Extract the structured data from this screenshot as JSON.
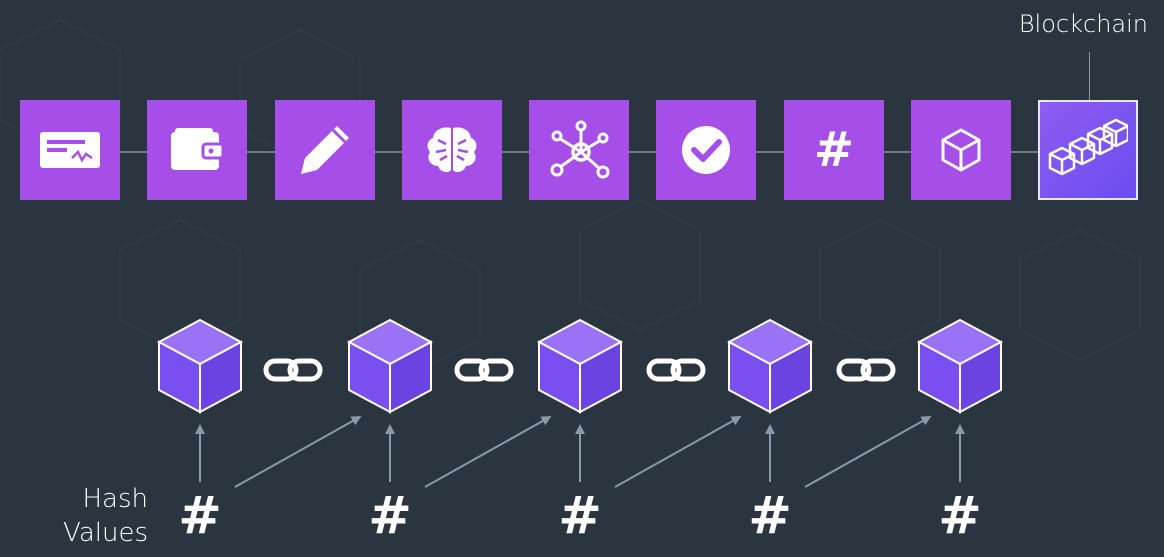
{
  "header": {
    "label": "Blockchain"
  },
  "pipeline": {
    "steps": [
      {
        "icon": "check-document-icon"
      },
      {
        "icon": "wallet-icon"
      },
      {
        "icon": "pencil-icon"
      },
      {
        "icon": "brain-icon"
      },
      {
        "icon": "network-icon"
      },
      {
        "icon": "checkmark-circle-icon"
      },
      {
        "icon": "hash-icon"
      },
      {
        "icon": "cube-icon"
      },
      {
        "icon": "blockchain-cubes-icon"
      }
    ],
    "active_index": 8
  },
  "chain": {
    "hash_label_line1": "Hash",
    "hash_label_line2": "Values",
    "hash_symbol": "#",
    "block_count": 5
  },
  "colors": {
    "background": "#2b3540",
    "step_fill": "#a54ee8",
    "cube_front": "#7a4ff0",
    "arrow": "#8a9aaa"
  }
}
